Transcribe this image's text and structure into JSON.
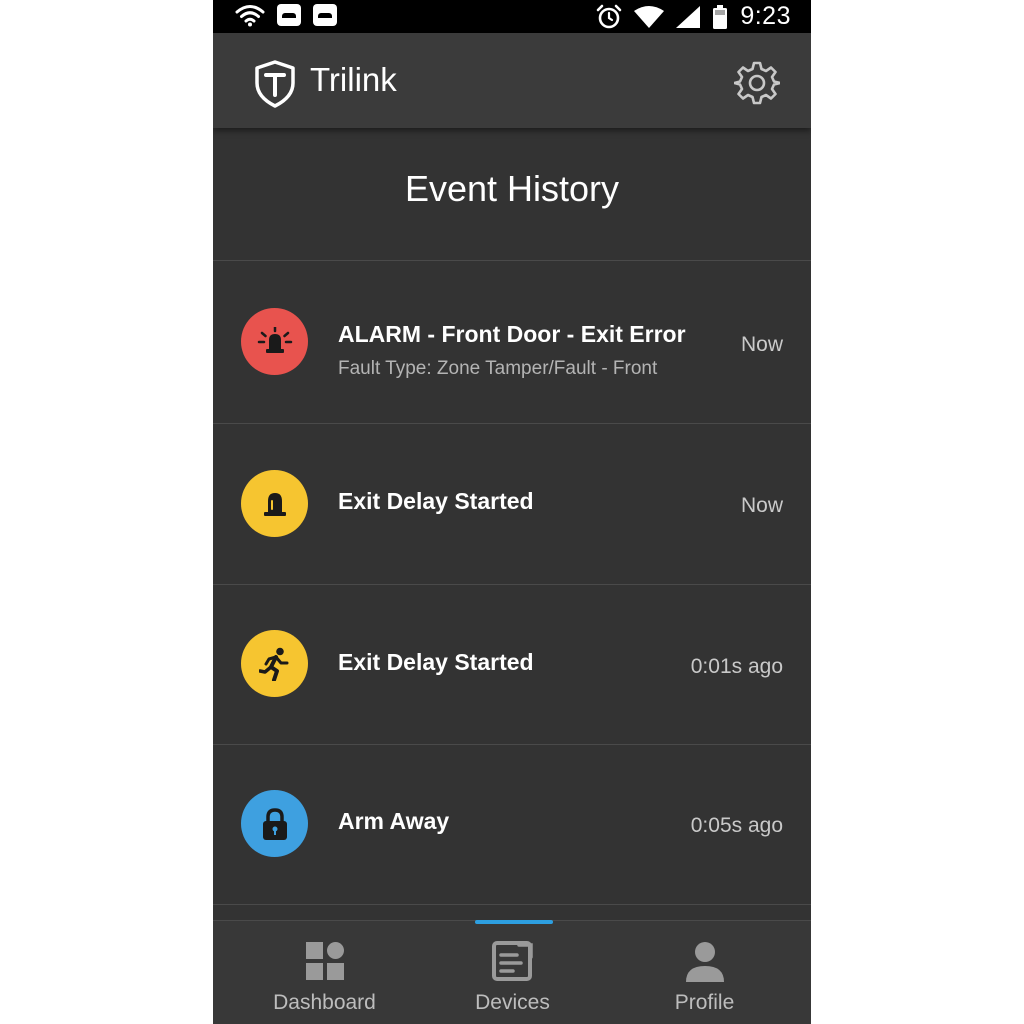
{
  "status_bar": {
    "time": "9:23",
    "icons": [
      "wifi-icon",
      "notification-icon",
      "notification-icon",
      "alarm-clock-icon",
      "wifi-signal-icon",
      "cell-signal-icon",
      "battery-icon"
    ]
  },
  "header": {
    "brand": "Trilink",
    "logo_icon": "shield-t-logo",
    "settings_icon": "gear-icon"
  },
  "page": {
    "title": "Event History"
  },
  "events": [
    {
      "title": "ALARM - Front Door - Exit Error",
      "subtitle": "Fault Type: Zone Tamper/Fault - Front",
      "time": "Now",
      "icon": "siren-icon",
      "color": "#e8534e"
    },
    {
      "title": "Exit Delay Started",
      "subtitle": "",
      "time": "Now",
      "icon": "siren-icon",
      "color": "#f6c530"
    },
    {
      "title": "Exit Delay Started",
      "subtitle": "",
      "time": "0:01s ago",
      "icon": "running-person-icon",
      "color": "#f6c530"
    },
    {
      "title": "Arm Away",
      "subtitle": "",
      "time": "0:05s ago",
      "icon": "lock-icon",
      "color": "#3ea0e0"
    }
  ],
  "bottom_nav": {
    "items": [
      {
        "label": "Dashboard",
        "icon": "dashboard-icon",
        "active": false
      },
      {
        "label": "Devices",
        "icon": "devices-icon",
        "active": true
      },
      {
        "label": "Profile",
        "icon": "person-icon",
        "active": false
      }
    ],
    "active_color": "#2d9fe0"
  },
  "colors": {
    "background": "#333333",
    "header": "#3b3b3b",
    "alarm_red": "#e8534e",
    "warning_yellow": "#f6c530",
    "armed_blue": "#3ea0e0"
  }
}
